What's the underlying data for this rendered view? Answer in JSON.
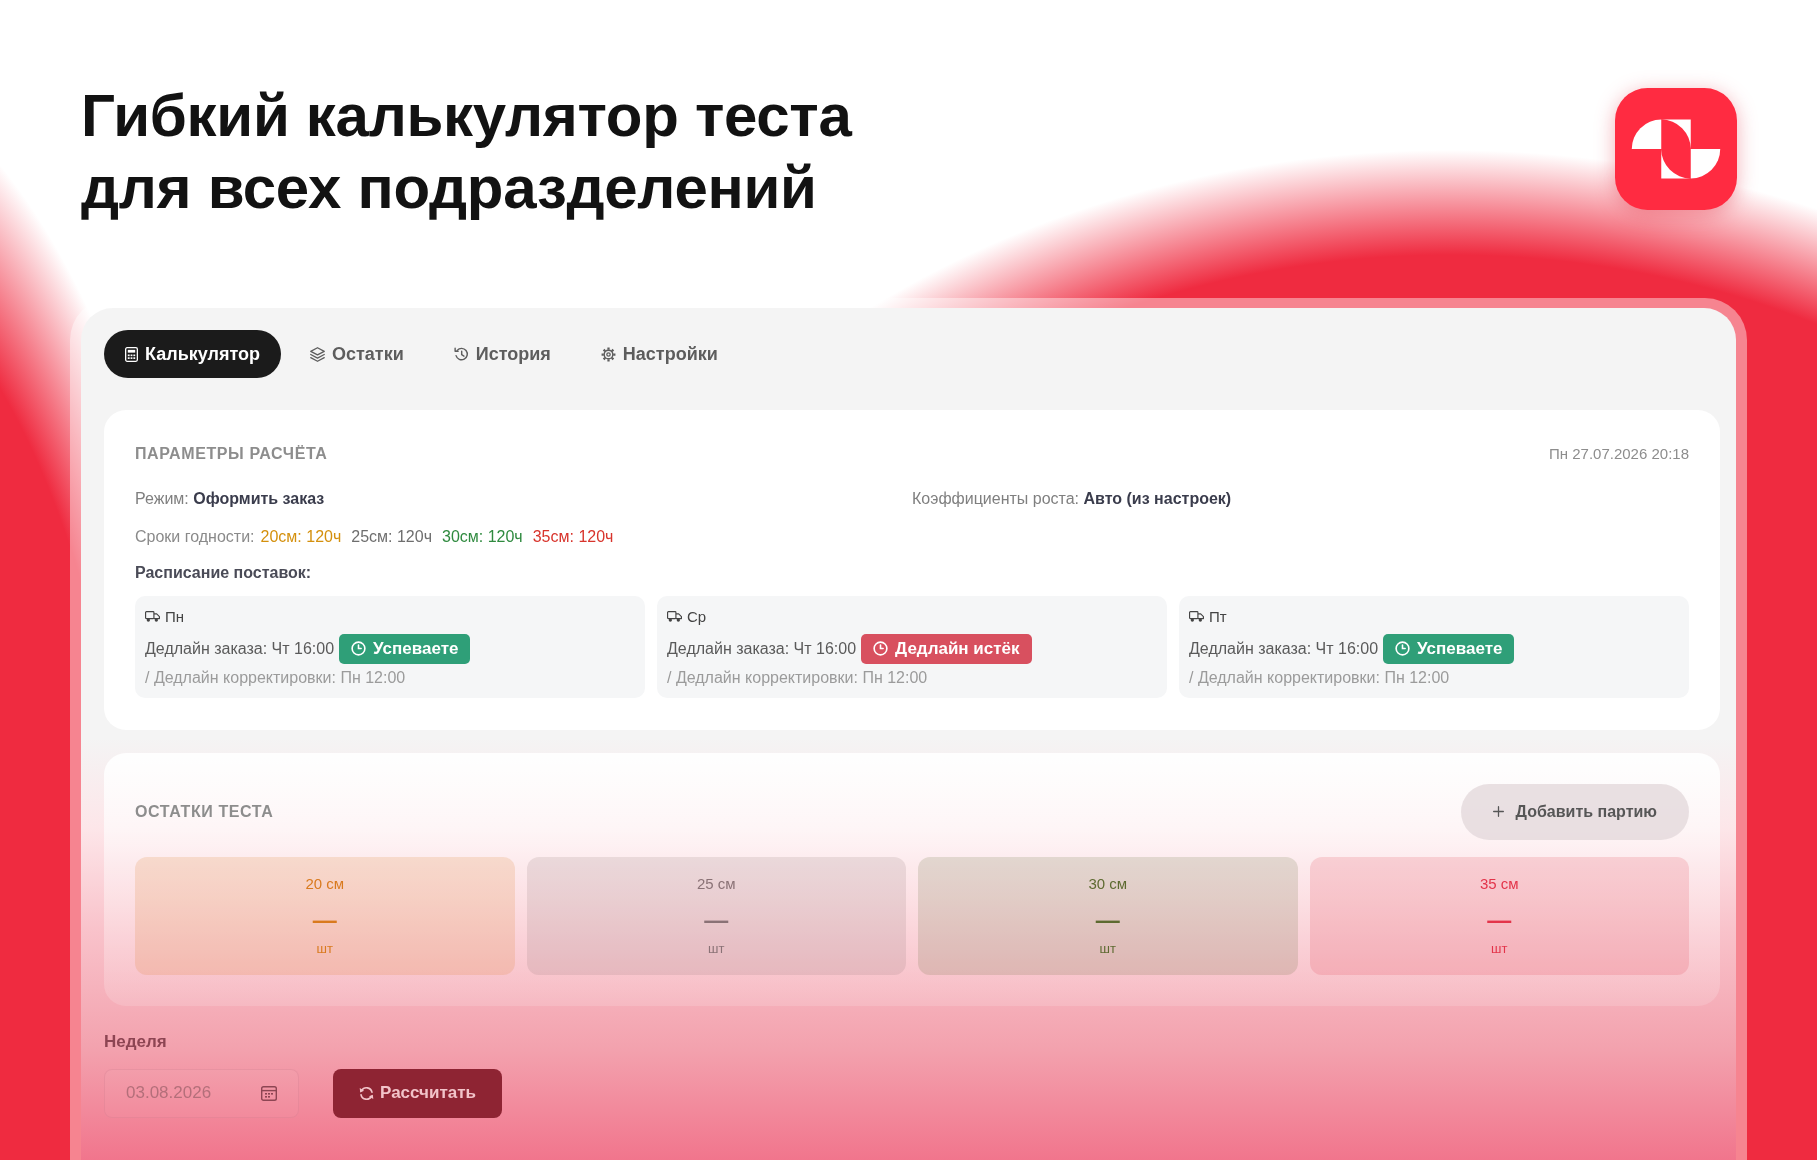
{
  "headline": {
    "title": "Гибкий калькулятор теста\nдля всех подразделений"
  },
  "tabs": [
    {
      "label": "Калькулятор",
      "selected": true
    },
    {
      "label": "Остатки",
      "selected": false
    },
    {
      "label": "История",
      "selected": false
    },
    {
      "label": "Настройки",
      "selected": false
    }
  ],
  "parameters": {
    "title": "ПАРАМЕТРЫ РАСЧЁТА",
    "timestamp": "Пн 27.07.2026 20:18",
    "mode": "Режим: **Оформить заказ**",
    "growth_factors": "Коэффициенты роста: **Авто (из настроек)**",
    "shelf_life": {
      "label": "Сроки годности:",
      "items": [
        {
          "text": "20см: 120ч",
          "color": "#d4900d"
        },
        {
          "text": "25см: 120ч",
          "color": "#6e6e6e"
        },
        {
          "text": "30см: 120ч",
          "color": "#2f8a3f"
        },
        {
          "text": "35см: 120ч",
          "color": "#d8342c"
        }
      ]
    },
    "schedule_title": "Расписание поставок:",
    "deliveries": [
      {
        "day": "Пн",
        "order_deadline": "Дедлайн заказа: Чт 16:00",
        "status": {
          "kind": "on_time",
          "label": "Успеваете"
        },
        "correction_deadline": "/ Дедлайн корректировки: Пн 12:00"
      },
      {
        "day": "Ср",
        "order_deadline": "Дедлайн заказа: Чт 16:00",
        "status": {
          "kind": "expired",
          "label": "Дедлайн истёк"
        },
        "correction_deadline": "/ Дедлайн корректировки: Пн 12:00"
      },
      {
        "day": "Пт",
        "order_deadline": "Дедлайн заказа: Чт 16:00",
        "status": {
          "kind": "on_time",
          "label": "Успеваете"
        },
        "correction_deadline": "/ Дедлайн корректировки: Пн 12:00"
      }
    ]
  },
  "dough_stock": {
    "title": "ОСТАТКИ ТЕСТА",
    "add_button": "Добавить партию",
    "tiles": [
      {
        "size": "20 см",
        "value": "—",
        "unit": "шт",
        "color": "#d97a1e"
      },
      {
        "size": "25 см",
        "value": "—",
        "unit": "шт",
        "color": "#8a7276"
      },
      {
        "size": "30 см",
        "value": "—",
        "unit": "шт",
        "color": "#5d6a30"
      },
      {
        "size": "35 см",
        "value": "—",
        "unit": "шт",
        "color": "#e3344a"
      }
    ]
  },
  "week": {
    "label": "Неделя",
    "value": "03.08.2026"
  },
  "calculate_button": "Рассчитать"
}
